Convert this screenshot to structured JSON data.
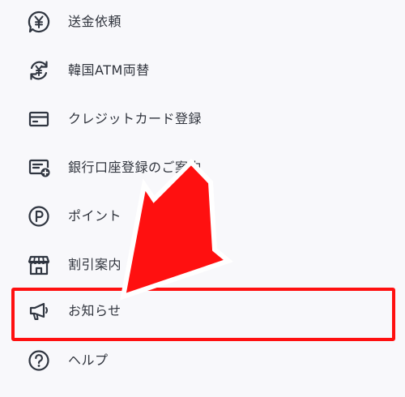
{
  "menu": {
    "items": [
      {
        "label": "送金依頼",
        "icon": "yen-coin-icon"
      },
      {
        "label": "韓国ATM両替",
        "icon": "yen-exchange-icon"
      },
      {
        "label": "クレジットカード登録",
        "icon": "credit-card-icon"
      },
      {
        "label": "銀行口座登録のご案内",
        "icon": "bank-card-add-icon"
      },
      {
        "label": "ポイント",
        "icon": "points-icon"
      },
      {
        "label": "割引案内",
        "icon": "shop-icon"
      },
      {
        "label": "お知らせ",
        "icon": "megaphone-icon"
      },
      {
        "label": "ヘルプ",
        "icon": "help-icon"
      }
    ]
  },
  "colors": {
    "text": "#30343d",
    "icon": "#2f3540",
    "highlight": "#ff1010",
    "arrow": "#ff1010",
    "background": "#f8f8fb"
  },
  "annotation": {
    "highlighted_item": "お知らせ",
    "arrow_points_to": "お知らせ"
  }
}
